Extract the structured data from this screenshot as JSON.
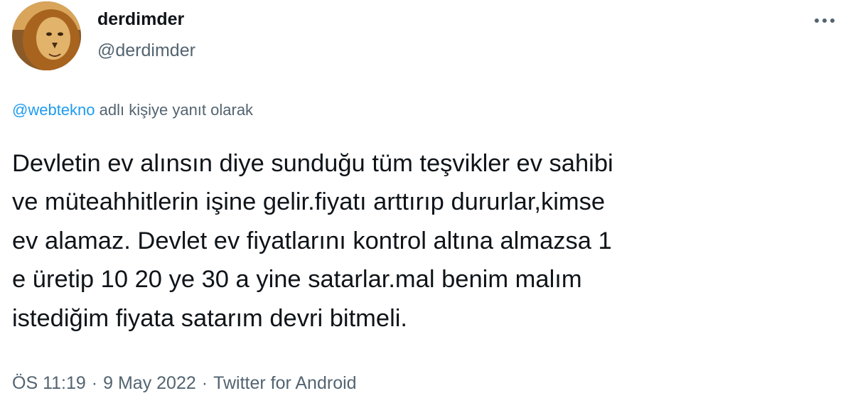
{
  "author": {
    "display_name": "derdimder",
    "handle": "@derdimder",
    "avatar_icon": "lion-avatar"
  },
  "more_icon": "more-horizontal-icon",
  "reply": {
    "mention": "@webtekno",
    "suffix": " adlı kişiye yanıt olarak"
  },
  "tweet": {
    "text": "Devletin ev alınsın diye sunduğu tüm teşvikler ev sahibi\nve müteahhitlerin işine gelir.fiyatı arttırıp dururlar,kimse\nev alamaz. Devlet ev fiyatlarını kontrol altına almazsa 1\ne üretip 10 20 ye 30 a yine satarlar.mal benim malım\nistediğim fiyata satarım devri bitmeli."
  },
  "meta": {
    "time": "ÖS 11:19",
    "separator": "·",
    "date": "9 May 2022",
    "source": "Twitter for Android"
  },
  "colors": {
    "text": "#0f1419",
    "secondary": "#536471",
    "link": "#1d9bf0"
  }
}
